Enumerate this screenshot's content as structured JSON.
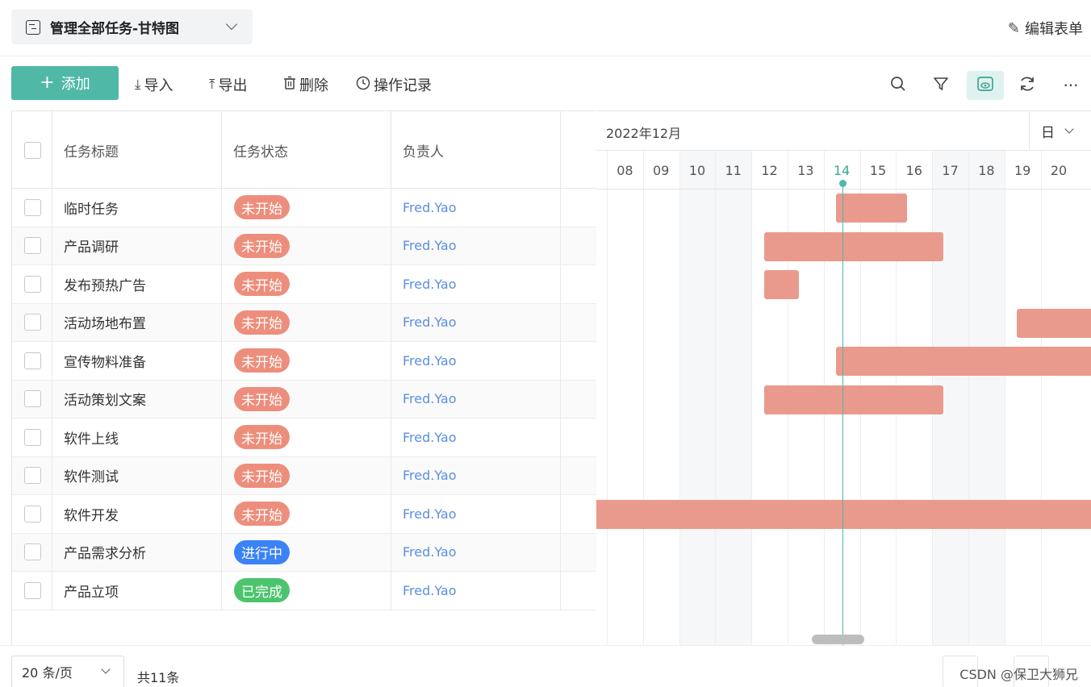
{
  "header": {
    "view_title": "管理全部任务-甘特图",
    "edit_form_label": "编辑表单"
  },
  "toolbar": {
    "add_label": "添加",
    "import_label": "导入",
    "export_label": "导出",
    "delete_label": "删除",
    "history_label": "操作记录"
  },
  "table": {
    "headers": {
      "title": "任务标题",
      "status": "任务状态",
      "owner": "负责人"
    },
    "rows": [
      {
        "title": "临时任务",
        "status": "未开始",
        "owner": "Fred.Yao"
      },
      {
        "title": "产品调研",
        "status": "未开始",
        "owner": "Fred.Yao"
      },
      {
        "title": "发布预热广告",
        "status": "未开始",
        "owner": "Fred.Yao"
      },
      {
        "title": "活动场地布置",
        "status": "未开始",
        "owner": "Fred.Yao"
      },
      {
        "title": "宣传物料准备",
        "status": "未开始",
        "owner": "Fred.Yao"
      },
      {
        "title": "活动策划文案",
        "status": "未开始",
        "owner": "Fred.Yao"
      },
      {
        "title": "软件上线",
        "status": "未开始",
        "owner": "Fred.Yao"
      },
      {
        "title": "软件测试",
        "status": "未开始",
        "owner": "Fred.Yao"
      },
      {
        "title": "软件开发",
        "status": "未开始",
        "owner": "Fred.Yao"
      },
      {
        "title": "产品需求分析",
        "status": "进行中",
        "owner": "Fred.Yao"
      },
      {
        "title": "产品立项",
        "status": "已完成",
        "owner": "Fred.Yao"
      }
    ]
  },
  "status_colors": {
    "未开始": "#ed8e7c",
    "进行中": "#3b82f6",
    "已完成": "#4cc46e"
  },
  "gantt": {
    "month": "2022年12月",
    "unit": "日",
    "days": [
      "08",
      "09",
      "10",
      "11",
      "12",
      "13",
      "14",
      "15",
      "16",
      "17",
      "18",
      "19",
      "20"
    ],
    "today": "14",
    "weekend_days": [
      "10",
      "11",
      "17",
      "18"
    ]
  },
  "footer": {
    "page_size": "20 条/页",
    "total": "共11条",
    "credit": "CSDN @保卫大狮兄"
  },
  "colors": {
    "accent": "#4fb8a6",
    "bar": "#ea9a8c",
    "owner_link": "#5b8fde"
  }
}
